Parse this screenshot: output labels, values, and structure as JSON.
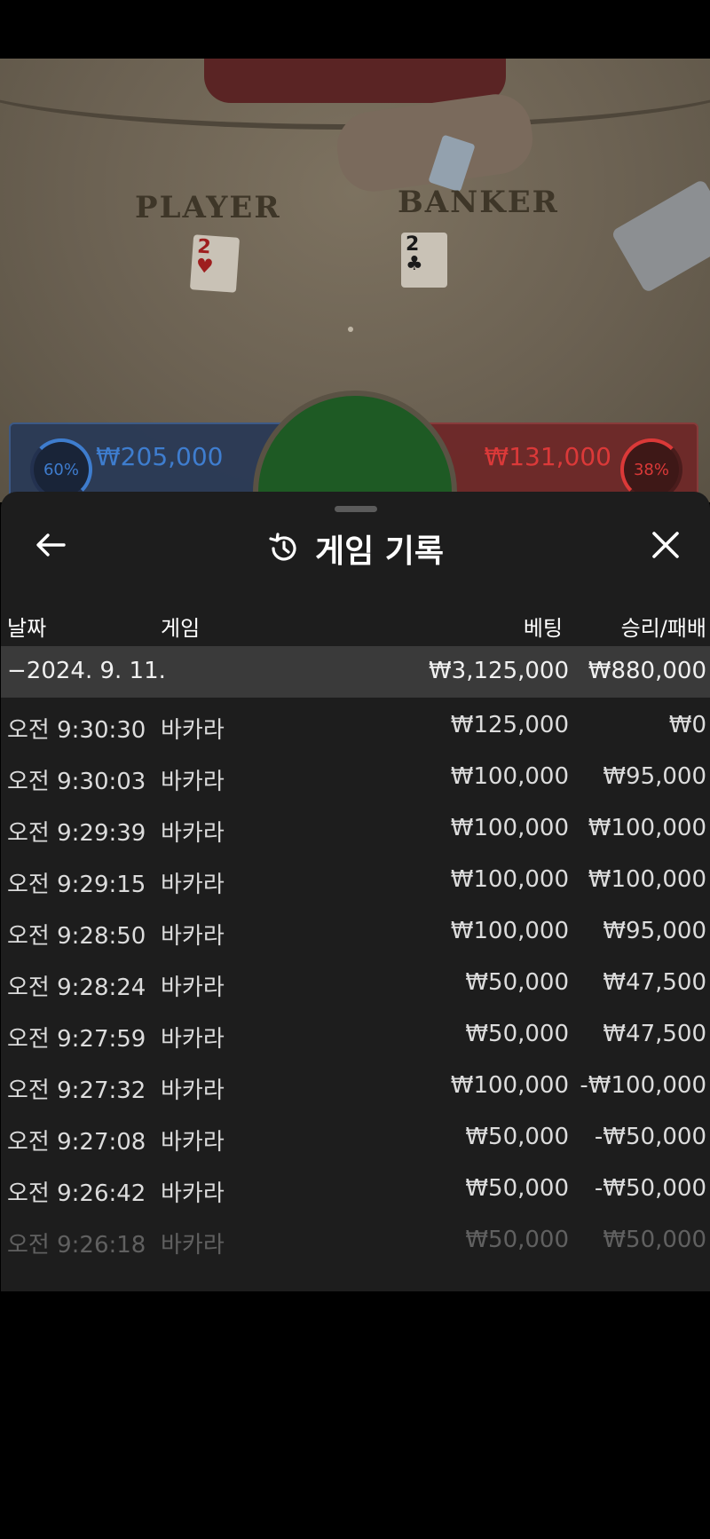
{
  "video": {
    "player_label": "PLAYER",
    "banker_label": "BANKER",
    "player_card_rank": "2",
    "player_card_suit": "♥",
    "banker_card_rank": "2",
    "banker_card_suit": "♣",
    "player_percent": "60%",
    "player_bet_total": "₩205,000",
    "banker_percent": "38%",
    "banker_bet_total": "₩131,000"
  },
  "sheet": {
    "title": "게임 기록",
    "icons": {
      "back": "arrow-left-icon",
      "history": "history-icon",
      "close": "close-icon"
    },
    "columns": {
      "date": "날짜",
      "game": "게임",
      "bet": "베팅",
      "winloss": "승리/패배"
    },
    "date_group": {
      "date": "−2024. 9. 11.",
      "bet_total": "₩3,125,000",
      "winloss_total": "₩880,000"
    },
    "rows": [
      {
        "time": "오전 9:30:30",
        "game": "바카라",
        "bet": "₩125,000",
        "winloss": "₩0"
      },
      {
        "time": "오전 9:30:03",
        "game": "바카라",
        "bet": "₩100,000",
        "winloss": "₩95,000"
      },
      {
        "time": "오전 9:29:39",
        "game": "바카라",
        "bet": "₩100,000",
        "winloss": "₩100,000"
      },
      {
        "time": "오전 9:29:15",
        "game": "바카라",
        "bet": "₩100,000",
        "winloss": "₩100,000"
      },
      {
        "time": "오전 9:28:50",
        "game": "바카라",
        "bet": "₩100,000",
        "winloss": "₩95,000"
      },
      {
        "time": "오전 9:28:24",
        "game": "바카라",
        "bet": "₩50,000",
        "winloss": "₩47,500"
      },
      {
        "time": "오전 9:27:59",
        "game": "바카라",
        "bet": "₩50,000",
        "winloss": "₩47,500"
      },
      {
        "time": "오전 9:27:32",
        "game": "바카라",
        "bet": "₩100,000",
        "winloss": "-₩100,000"
      },
      {
        "time": "오전 9:27:08",
        "game": "바카라",
        "bet": "₩50,000",
        "winloss": "-₩50,000"
      },
      {
        "time": "오전 9:26:42",
        "game": "바카라",
        "bet": "₩50,000",
        "winloss": "-₩50,000"
      },
      {
        "time": "오전 9:26:18",
        "game": "바카라",
        "bet": "₩50,000",
        "winloss": "₩50,000"
      }
    ]
  }
}
